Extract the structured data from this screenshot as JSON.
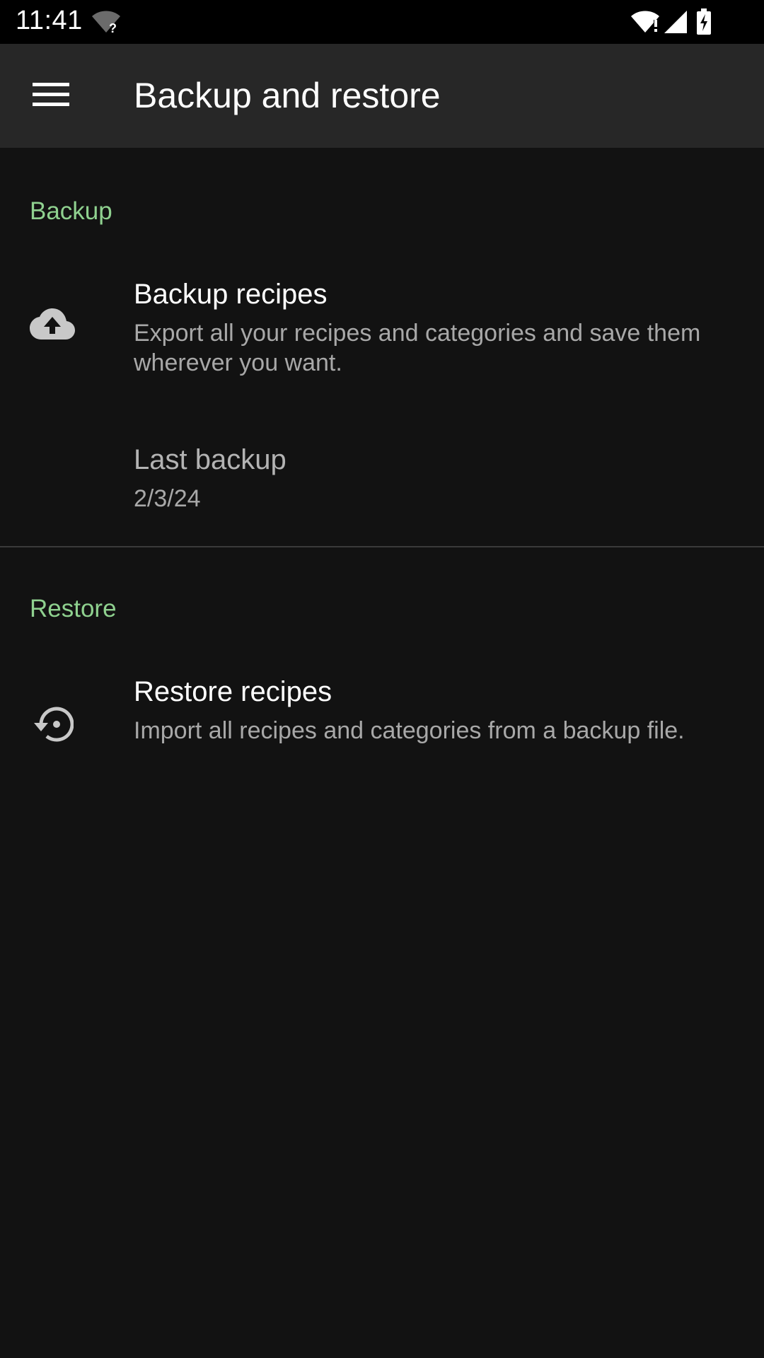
{
  "status_bar": {
    "time": "11:41",
    "icons": [
      "wifi-unknown-icon",
      "wifi-alert-icon",
      "cell-signal-icon",
      "battery-charging-icon"
    ]
  },
  "app_bar": {
    "menu_icon": "menu-icon",
    "title": "Backup and restore"
  },
  "sections": {
    "backup": {
      "header": "Backup",
      "backup_item": {
        "icon": "cloud-upload-icon",
        "title": "Backup recipes",
        "summary": "Export all your recipes and categories and save them wherever you want."
      },
      "last_backup": {
        "title": "Last backup",
        "summary": "2/3/24"
      }
    },
    "restore": {
      "header": "Restore",
      "restore_item": {
        "icon": "restore-icon",
        "title": "Restore recipes",
        "summary": "Import all recipes and categories from a backup file."
      }
    }
  },
  "colors": {
    "accent": "#8fd18f",
    "background": "#121212",
    "app_bar": "#272727",
    "status_bar": "#000000"
  }
}
